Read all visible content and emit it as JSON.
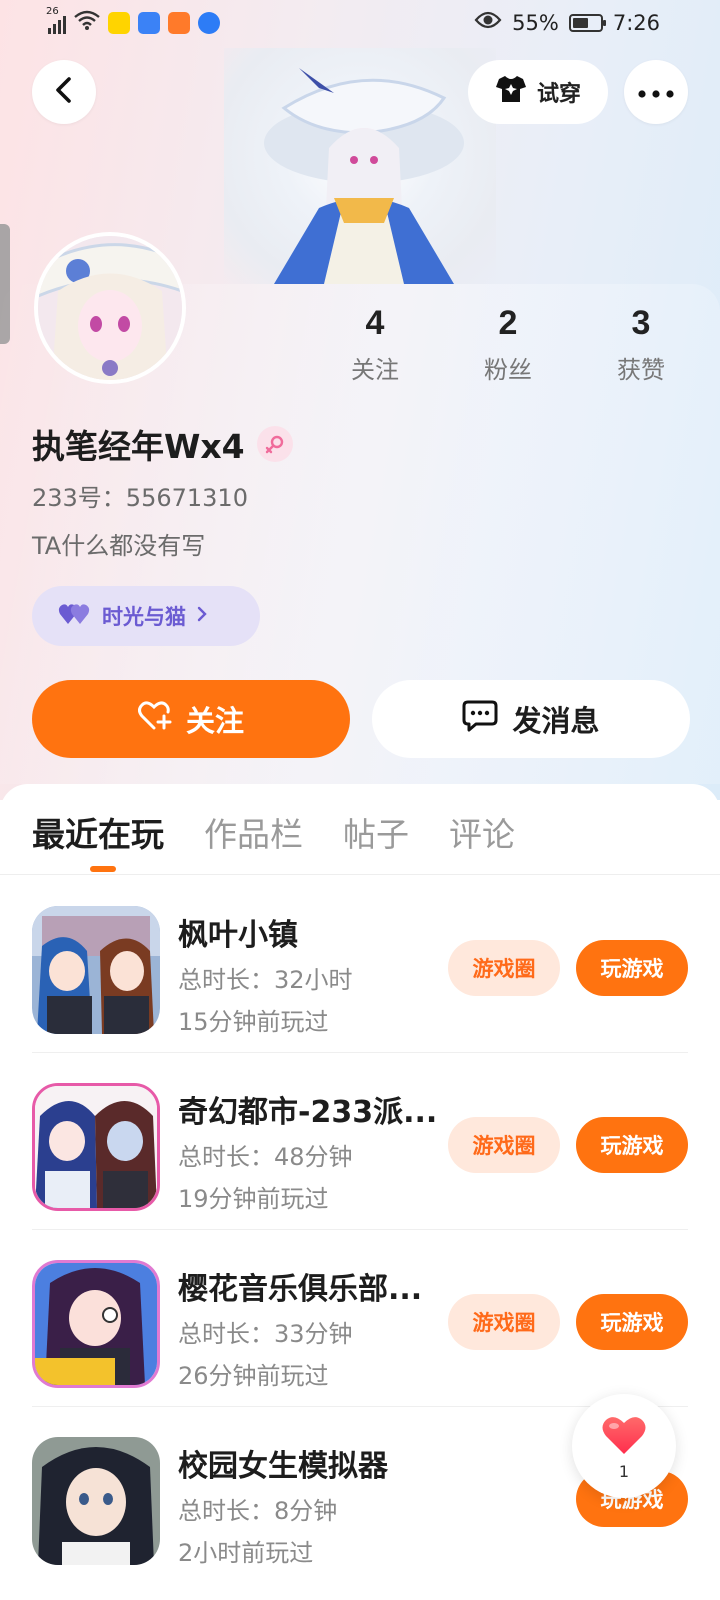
{
  "status_bar": {
    "network": "26",
    "battery": "55%",
    "time": "7:26",
    "icons": [
      "signal-icon",
      "wifi-icon",
      "meituan-app-icon",
      "app-icon-blue",
      "video-app-icon",
      "browser-app-icon",
      "eye-icon",
      "battery-icon"
    ]
  },
  "header": {
    "try_on_label": "试穿",
    "back_icon": "chevron-left-icon",
    "more_icon": "more-dots-icon"
  },
  "profile": {
    "username": "执笔经年Wx4",
    "uid_line": "233号：55671310",
    "bio": "TA什么都没有写",
    "family_badge": "时光与猫",
    "stats": [
      {
        "value": "4",
        "label": "关注"
      },
      {
        "value": "2",
        "label": "粉丝"
      },
      {
        "value": "3",
        "label": "获赞"
      }
    ]
  },
  "actions": {
    "follow_label": "关注",
    "message_label": "发消息"
  },
  "tabs": [
    {
      "label": "最近在玩",
      "active": true
    },
    {
      "label": "作品栏",
      "active": false
    },
    {
      "label": "帖子",
      "active": false
    },
    {
      "label": "评论",
      "active": false
    }
  ],
  "games": [
    {
      "name": "枫叶小镇",
      "total": "总时长：32小时",
      "last": "15分钟前玩过",
      "circle_label": "游戏圈",
      "play_label": "玩游戏"
    },
    {
      "name": "奇幻都市-233派...",
      "total": "总时长：48分钟",
      "last": "19分钟前玩过",
      "circle_label": "游戏圈",
      "play_label": "玩游戏"
    },
    {
      "name": "樱花音乐俱乐部...",
      "total": "总时长：33分钟",
      "last": "26分钟前玩过",
      "circle_label": "游戏圈",
      "play_label": "玩游戏"
    },
    {
      "name": "校园女生模拟器",
      "total": "总时长：8分钟",
      "last": "2小时前玩过",
      "circle_label": "",
      "play_label": "玩游戏"
    }
  ],
  "float_like": {
    "count": "1"
  },
  "colors": {
    "accent": "#ff7310",
    "accent_soft": "#ffe8dc",
    "family_purple": "#6b5bd2"
  }
}
